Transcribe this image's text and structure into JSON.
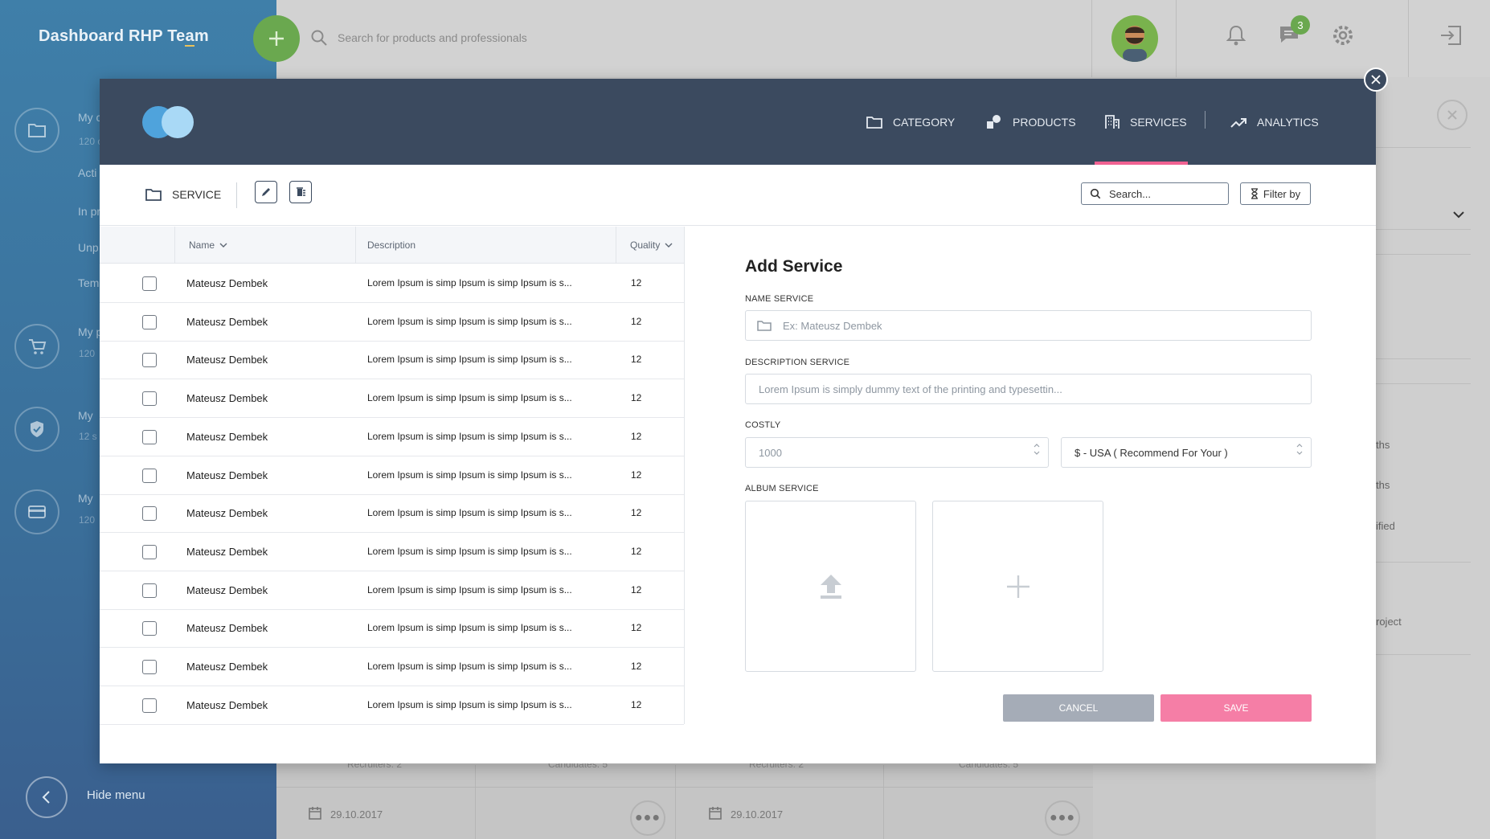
{
  "app": {
    "brand": "Dashboard RHP Team",
    "search_placeholder": "Search for products and professionals",
    "notification_count": "3",
    "hide_menu": "Hide menu"
  },
  "sidebar_partial": [
    {
      "label": "My c",
      "sub": "120 c",
      "icon": "folder-icon"
    },
    {
      "label": "Acti",
      "sub": "",
      "icon": ""
    },
    {
      "label": "In pr",
      "sub": "",
      "icon": ""
    },
    {
      "label": "Unp",
      "sub": "",
      "icon": ""
    },
    {
      "label": "Tem",
      "sub": "",
      "icon": ""
    },
    {
      "label": "My p",
      "sub": "120",
      "icon": "cart-icon"
    },
    {
      "label": "My",
      "sub": "12 s",
      "icon": "shield-icon"
    },
    {
      "label": "My",
      "sub": "120",
      "icon": "card-icon"
    }
  ],
  "background_cards": {
    "recruiters": "Recruiters: 2",
    "candidates": "Candidates: 5",
    "date": "29.10.2017"
  },
  "right_panel_partial": [
    "ths",
    "ths",
    "ified",
    "roject"
  ],
  "modal": {
    "nav": [
      {
        "label": "CATEGORY",
        "icon": "folder-icon",
        "active": false
      },
      {
        "label": "PRODUCTS",
        "icon": "products-icon",
        "active": false
      },
      {
        "label": "SERVICES",
        "icon": "building-icon",
        "active": true
      },
      {
        "label": "ANALYTICS",
        "icon": "trend-icon",
        "active": false
      }
    ],
    "toolbar": {
      "title": "SERVICE",
      "search_placeholder": "Search...",
      "filter_label": "Filter by"
    },
    "table": {
      "columns": [
        "Name",
        "Description",
        "Quality"
      ],
      "rows": [
        {
          "name": "Mateusz Dembek",
          "description": "Lorem Ipsum is simp  Ipsum is simp  Ipsum is s...",
          "quality": "12"
        },
        {
          "name": "Mateusz Dembek",
          "description": "Lorem Ipsum is simp  Ipsum is simp  Ipsum is s...",
          "quality": "12"
        },
        {
          "name": "Mateusz Dembek",
          "description": "Lorem Ipsum is simp  Ipsum is simp  Ipsum is s...",
          "quality": "12"
        },
        {
          "name": "Mateusz Dembek",
          "description": "Lorem Ipsum is simp  Ipsum is simp  Ipsum is s...",
          "quality": "12"
        },
        {
          "name": "Mateusz Dembek",
          "description": "Lorem Ipsum is simp  Ipsum is simp  Ipsum is s...",
          "quality": "12"
        },
        {
          "name": "Mateusz Dembek",
          "description": "Lorem Ipsum is simp  Ipsum is simp  Ipsum is s...",
          "quality": "12"
        },
        {
          "name": "Mateusz Dembek",
          "description": "Lorem Ipsum is simp  Ipsum is simp  Ipsum is s...",
          "quality": "12"
        },
        {
          "name": "Mateusz Dembek",
          "description": "Lorem Ipsum is simp  Ipsum is simp  Ipsum is s...",
          "quality": "12"
        },
        {
          "name": "Mateusz Dembek",
          "description": "Lorem Ipsum is simp  Ipsum is simp  Ipsum is s...",
          "quality": "12"
        },
        {
          "name": "Mateusz Dembek",
          "description": "Lorem Ipsum is simp  Ipsum is simp  Ipsum is s...",
          "quality": "12"
        },
        {
          "name": "Mateusz Dembek",
          "description": "Lorem Ipsum is simp  Ipsum is simp  Ipsum is s...",
          "quality": "12"
        },
        {
          "name": "Mateusz Dembek",
          "description": "Lorem Ipsum is simp  Ipsum is simp  Ipsum is s...",
          "quality": "12"
        }
      ]
    },
    "form": {
      "title": "Add Service",
      "name_label": "NAME SERVICE",
      "name_placeholder": "Ex: Mateusz Dembek",
      "description_label": "DESCRIPTION SERVICE",
      "description_placeholder": "Lorem Ipsum is simply dummy text of the printing and typesettin...",
      "costly_label": "COSTLY",
      "costly_value": "1000",
      "currency_value": "$ - USA ( Recommend For Your )",
      "album_label": "ALBUM SERVICE",
      "cancel": "CANCEL",
      "save": "SAVE"
    }
  },
  "colors": {
    "modal_header": "#3b4a5f",
    "active_tab": "#f06292",
    "save_button": "#f57ea6",
    "cancel_button": "#a5acb7",
    "add_button": "#6aa84f"
  }
}
